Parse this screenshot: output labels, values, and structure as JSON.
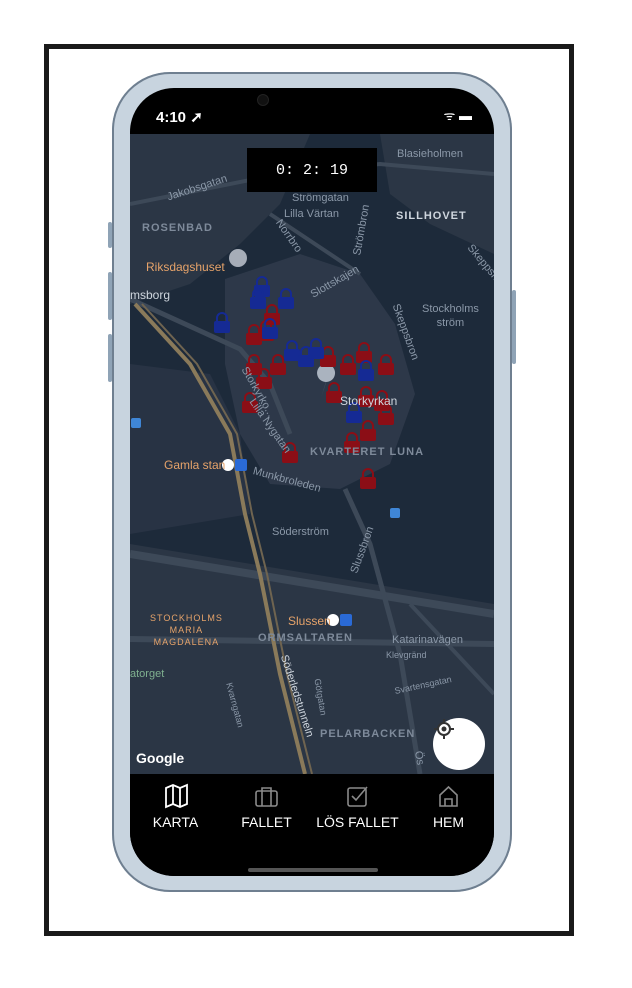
{
  "status_bar": {
    "time": "4:10 ➚",
    "icons": "ᯤ ▬"
  },
  "timer": {
    "text": "0: 2: 19"
  },
  "map": {
    "attribution": "Google",
    "labels": {
      "blasieholmen": "Blasieholmen",
      "jakobsgatan": "Jakobsgatan",
      "stromgatan": "Strömgatan",
      "lilla_vartan": "Lilla Värtan",
      "rosenbad": "ROSENBAD",
      "sillhovet": "SILLHOVET",
      "nortbro": "Norrbro",
      "strombron": "Strömbron",
      "riksdagshuset": "Riksdagshuset",
      "skeppsholm": "Skeppsh...",
      "msborg": "msborg",
      "slottskajen": "Slottskajen",
      "stockholms_strom": "Stockholms\nström",
      "skeppsbron": "Skeppsbron",
      "storkyrko": "Storkyrko...",
      "storkyrkan": "Storkyrkan",
      "lilla_nygatan": "Lilla Nygatan",
      "kvarteret_luna": "KVARTERET LUNA",
      "gamla_stan": "Gamla stan",
      "munkbroleden": "Munkbroleden",
      "soderstrom": "Söderström",
      "slussbron": "Slussbron",
      "stockholms_maria": "STOCKHOLMS\nMARIA\nMAGDALENA",
      "slussen": "Slussen",
      "ormsaltaren": "ORMSALTAREN",
      "katarinavagen": "Katarinavägen",
      "klevgrand": "Klevgränd",
      "atorget": "atorget",
      "soderledstunneln": "Söderledstunneln",
      "svartensgatan": "Svartensgatan",
      "kvarngatan": "Kvarngatan",
      "gotgatan": "Götgatan",
      "pelarbacken": "PELARBACKEN",
      "os": "Ös"
    },
    "markers_red_count": 26,
    "markers_blue_count": 11,
    "colors": {
      "red_lock": "#8b0e16",
      "blue_lock": "#152a94",
      "water": "#1d2a3a",
      "land": "#2b3645",
      "road": "#3d4958",
      "major_road": "#8a7a5a"
    }
  },
  "tabs": [
    {
      "label": "KARTA",
      "icon": "map-icon"
    },
    {
      "label": "FALLET",
      "icon": "briefcase-icon"
    },
    {
      "label": "LÖS FALLET",
      "icon": "checkbox-icon"
    },
    {
      "label": "HEM",
      "icon": "home-icon"
    }
  ]
}
